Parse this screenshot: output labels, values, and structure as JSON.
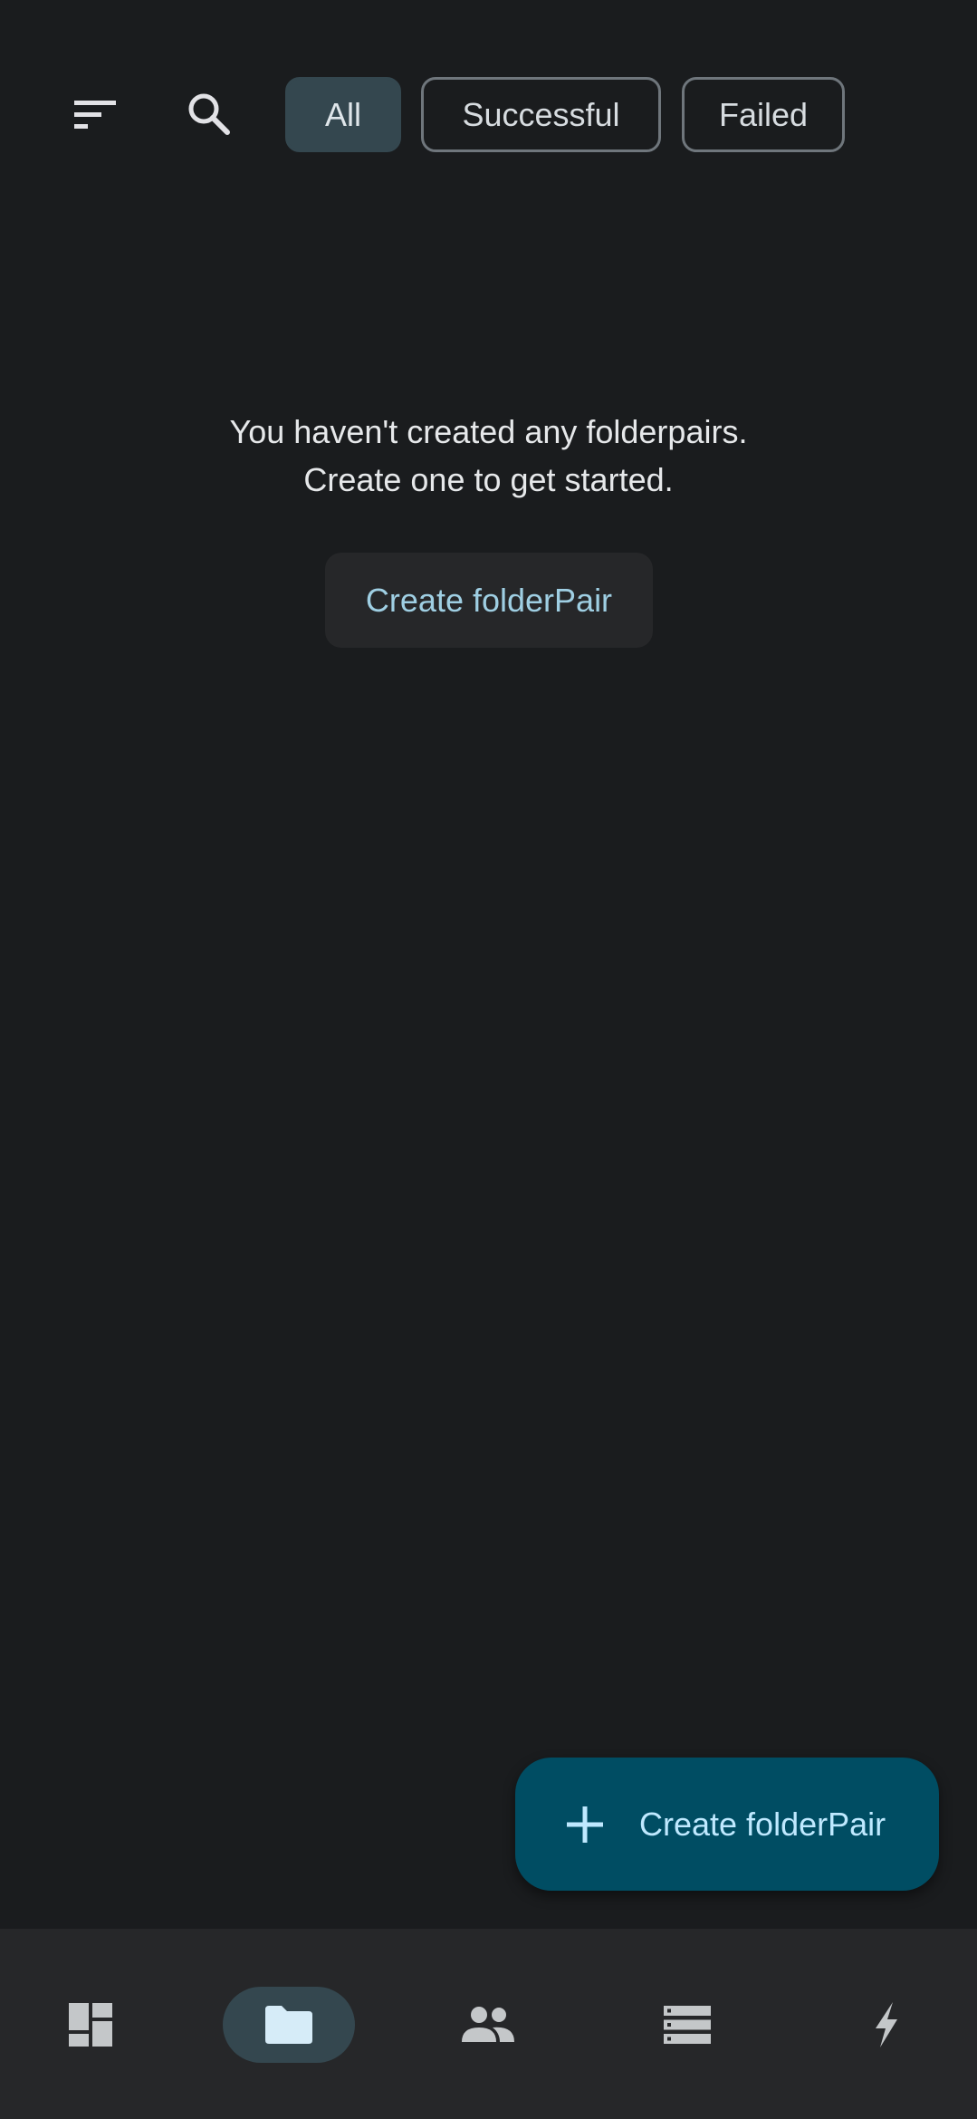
{
  "toolbar": {
    "sort_icon": "sort-icon",
    "search_icon": "search-icon",
    "filters": [
      {
        "label": "All",
        "selected": true
      },
      {
        "label": "Successful",
        "selected": false
      },
      {
        "label": "Failed",
        "selected": false
      }
    ]
  },
  "empty_state": {
    "line1": "You haven't created any folderpairs.",
    "line2": "Create one to get started.",
    "button_label": "Create folderPair"
  },
  "fab": {
    "icon": "plus-icon",
    "label": "Create folderPair"
  },
  "bottom_nav": {
    "items": [
      {
        "icon": "dashboard-icon",
        "active": false
      },
      {
        "icon": "folder-icon",
        "active": true
      },
      {
        "icon": "people-icon",
        "active": false
      },
      {
        "icon": "storage-icon",
        "active": false
      },
      {
        "icon": "bolt-icon",
        "active": false
      }
    ]
  },
  "colors": {
    "background": "#1a1c1e",
    "chip_selected": "#34474f",
    "fab_background": "#004d63",
    "fab_text": "#bfe9ff",
    "link_text": "#9fcfe3",
    "nav_background": "#262729"
  }
}
